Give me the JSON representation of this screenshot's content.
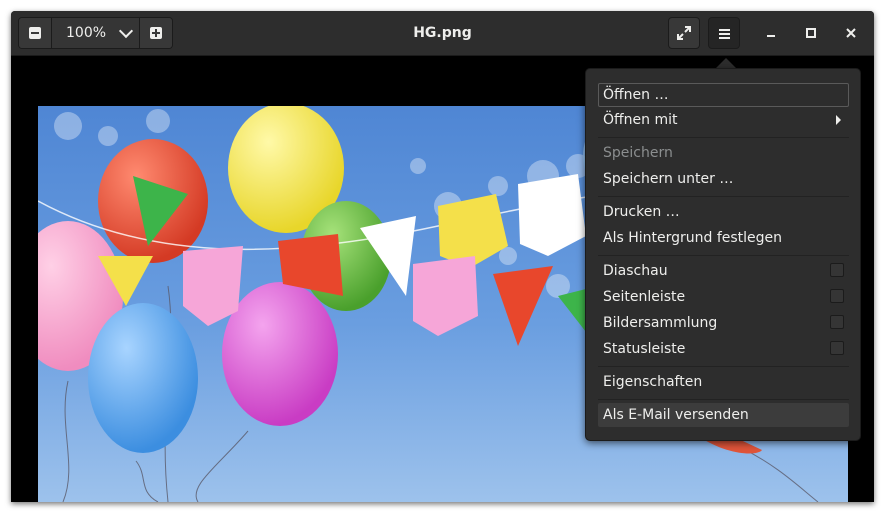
{
  "toolbar": {
    "zoom_value": "100%",
    "zoom_out_icon": "minus-icon",
    "zoom_in_icon": "plus-icon",
    "dropdown_icon": "chevron-down-icon"
  },
  "window": {
    "title": "HG.png",
    "fullscreen_icon": "expand-icon",
    "menu_icon": "hamburger-icon",
    "minimize_icon": "minimize-icon",
    "maximize_icon": "maximize-icon",
    "close_icon": "close-icon"
  },
  "menu": {
    "open": "Öffnen …",
    "open_with": "Öffnen mit",
    "save": "Speichern",
    "save_as": "Speichern unter …",
    "print": "Drucken …",
    "set_background": "Als Hintergrund festlegen",
    "slideshow": "Diaschau",
    "sidebar": "Seitenleiste",
    "gallery": "Bildersammlung",
    "statusbar": "Statusleiste",
    "properties": "Eigenschaften",
    "email": "Als E-Mail versenden"
  },
  "colors": {
    "headerbar": "#2d2d2d",
    "text": "#eeeeec",
    "disabled_text": "#8b8e8f",
    "sky_blue": "#5b8fd8"
  }
}
